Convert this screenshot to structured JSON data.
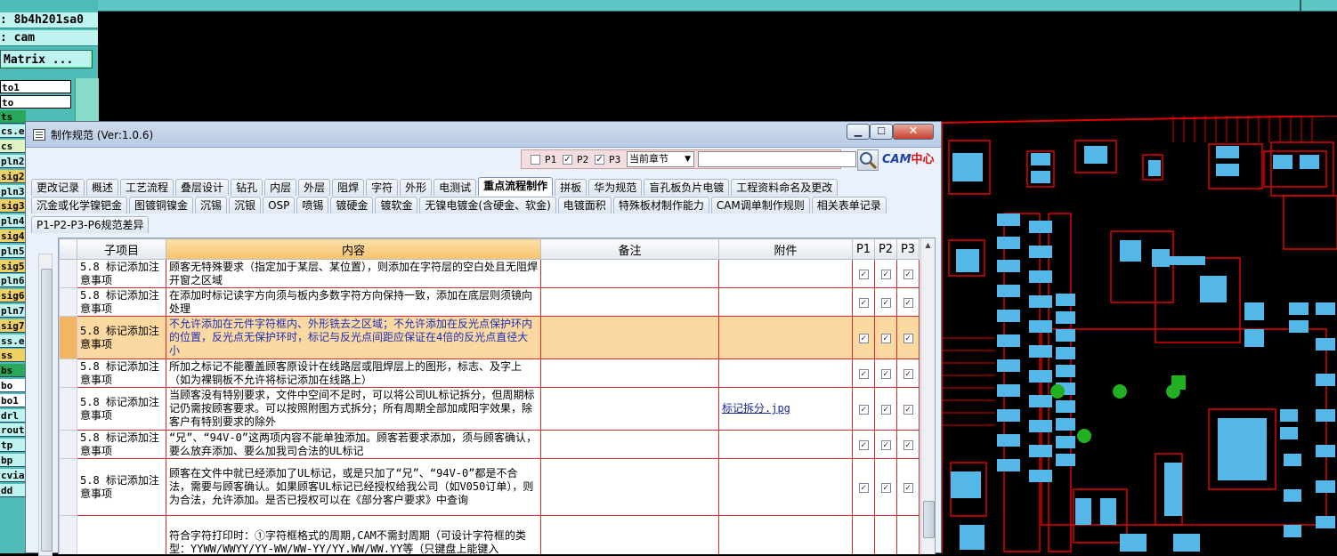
{
  "cam_panel": {
    "job_line": ": 8b4h201sa0",
    "step_line": ": cam",
    "matrix_button": "Matrix ...",
    "layers": [
      "to1",
      "to",
      "ts",
      "cs.e",
      "cs",
      "pln2",
      "sig2",
      "pln3",
      "sig3",
      "pln4",
      "sig4",
      "pln5",
      "sig5",
      "pln6",
      "sig6",
      "pln7",
      "sig7",
      "ss.e",
      "ss",
      "bs",
      "bo",
      "bo1",
      "drl",
      "rout",
      "tp",
      "bp",
      "cvia",
      "dd"
    ]
  },
  "dialog": {
    "title": "制作规范 (Ver:1.0.6)",
    "filters": {
      "p1": "P1",
      "p2": "P2",
      "p3": "P3",
      "p1_checked": false,
      "p2_checked": true,
      "p3_checked": true
    },
    "chapter_select": "当前章节",
    "search_placeholder": "",
    "logo_text_a": "CAM",
    "logo_text_b": "中心",
    "tabs_row1": [
      "更改记录",
      "概述",
      "工艺流程",
      "叠层设计",
      "钻孔",
      "内层",
      "外层",
      "阻焊",
      "字符",
      "外形",
      "电测试",
      "重点流程制作",
      "拼板",
      "华为规范",
      "盲孔板负片电镀",
      "工程资料命名及更改"
    ],
    "active_tab": "重点流程制作",
    "tabs_row2": [
      "沉金或化学镍钯金",
      "图镀铜镍金",
      "沉锡",
      "沉银",
      "OSP",
      "喷锡",
      "镀硬金",
      "镀软金",
      "无镍电镀金(含硬金、软金)",
      "电镀面积",
      "特殊板材制作能力",
      "CAM调单制作规则",
      "相关表单记录"
    ],
    "tabs_row3": [
      "P1-P2-P3-P6规范差异"
    ]
  },
  "table": {
    "columns": [
      "子项目",
      "内容",
      "备注",
      "附件",
      "P1",
      "P2",
      "P3"
    ],
    "rows": [
      {
        "sub": "5.8 标记添加注意事项",
        "content": "顾客无特殊要求（指定加于某层、某位置），则添加在字符层的空白处且无阻焊开窗之区域",
        "note": "",
        "attachment": "",
        "selected": false
      },
      {
        "sub": "5.8 标记添加注意事项",
        "content": "在添加时标记读字方向须与板内多数字符方向保持一致，添加在底层则须镜向处理",
        "note": "",
        "attachment": "",
        "selected": false
      },
      {
        "sub": "5.8 标记添加注意事项",
        "content": "不允许添加在元件字符框内、外形铣去之区域；不允许添加在反光点保护环内的位置，反光点无保护环时，标记与反光点间距应保证在4倍的反光点直径大小",
        "note": "",
        "attachment": "",
        "selected": true
      },
      {
        "sub": "5.8 标记添加注意事项",
        "content": "所加之标记不能覆盖顾客原设计在线路层或阻焊层上的图形，标志、及字上（如为裸铜板不允许将标记添加在线路上）",
        "note": "",
        "attachment": "",
        "selected": false
      },
      {
        "sub": "5.8 标记添加注意事项",
        "content": "当顾客没有特别要求，文件中空间不足时，可以将公司UL标记拆分，但周期标记仍需按顾客要求。可以按照附图方式拆分；所有周期全部加成阳字效果，除客户有特别要求的除外",
        "note": "",
        "attachment": "标记拆分.jpg",
        "selected": false
      },
      {
        "sub": "5.8 标记添加注意事项",
        "content": "“兄”、“94V-0”这两项内容不能单独添加。顾客若要求添加，须与顾客确认，要么放弃添加、要么加我司合法的UL标记",
        "note": "",
        "attachment": "",
        "selected": false
      },
      {
        "sub": "5.8 标记添加注意事项",
        "content": "顾客在文件中就已经添加了UL标记，或是只加了“兄”、“94V-0”都是不合法，需要与顾客确认。如果顾客UL标记已经授权给我公司（如V050订单），则为合法，允许添加。是否已授权可以在《部分客户要求》中查询",
        "note": "",
        "attachment": "",
        "selected": false
      },
      {
        "sub": "",
        "content": "符合字符打印时：①字符框格式的周期,CAM不需封周期（可设计字符框的类型：YYWW/WWYY/YY-WW/WW-YY/YY.WW/WW.YY等（只键盘上能键入",
        "note": "",
        "attachment": "",
        "selected": false
      }
    ]
  },
  "colors": {
    "pcb_red": "#e00000",
    "pad_blue": "#56b8e8",
    "pad_green": "#22b022",
    "cam_teal": "#4fbcb7",
    "row_select": "#fbd9a0",
    "grid_border": "#d52a2a"
  }
}
